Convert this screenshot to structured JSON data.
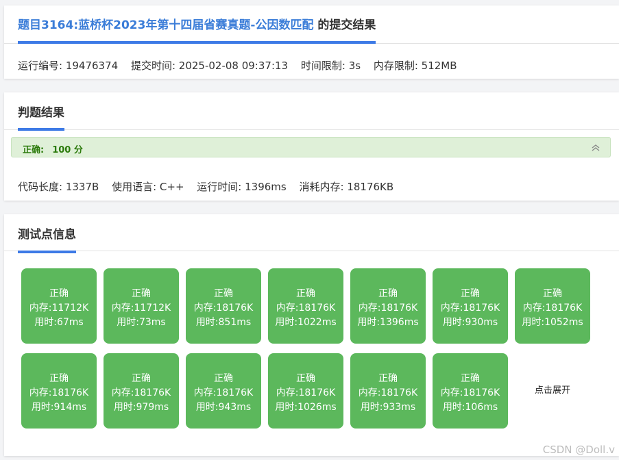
{
  "submission_panel": {
    "title_link": "题目3164:蓝桥杯2023年第十四届省赛真题-公因数匹配",
    "title_suffix": " 的提交结果",
    "run_id": "运行编号: 19476374",
    "submit_time": "提交时间: 2025-02-08 09:37:13",
    "time_limit": "时间限制: 3s",
    "memory_limit": "内存限制: 512MB"
  },
  "judge_panel": {
    "title": "判题结果",
    "status": "正确:",
    "score": "100 分",
    "code_length": "代码长度: 1337B",
    "language": "使用语言: C++",
    "run_time": "运行时间: 1396ms",
    "memory_used": "消耗内存: 18176KB",
    "collapse_icon": "double-chevron-up-icon"
  },
  "testcase_panel": {
    "title": "测试点信息",
    "cases": [
      {
        "status": "正确",
        "memory": "内存:11712K",
        "time": "用时:67ms"
      },
      {
        "status": "正确",
        "memory": "内存:11712K",
        "time": "用时:73ms"
      },
      {
        "status": "正确",
        "memory": "内存:18176K",
        "time": "用时:851ms"
      },
      {
        "status": "正确",
        "memory": "内存:18176K",
        "time": "用时:1022ms"
      },
      {
        "status": "正确",
        "memory": "内存:18176K",
        "time": "用时:1396ms"
      },
      {
        "status": "正确",
        "memory": "内存:18176K",
        "time": "用时:930ms"
      },
      {
        "status": "正确",
        "memory": "内存:18176K",
        "time": "用时:1052ms"
      },
      {
        "status": "正确",
        "memory": "内存:18176K",
        "time": "用时:914ms"
      },
      {
        "status": "正确",
        "memory": "内存:18176K",
        "time": "用时:979ms"
      },
      {
        "status": "正确",
        "memory": "内存:18176K",
        "time": "用时:943ms"
      },
      {
        "status": "正确",
        "memory": "内存:18176K",
        "time": "用时:1026ms"
      },
      {
        "status": "正确",
        "memory": "内存:18176K",
        "time": "用时:933ms"
      },
      {
        "status": "正确",
        "memory": "内存:18176K",
        "time": "用时:106ms"
      }
    ],
    "expand_label": "点击展开"
  },
  "watermark": "CSDN @Doll.v",
  "colors": {
    "accent": "#3d7ae6",
    "title_link": "#3b7dd8",
    "pass": "#5cb85c",
    "score_bg": "#dff0d8",
    "score_text": "#2b7a0b"
  }
}
